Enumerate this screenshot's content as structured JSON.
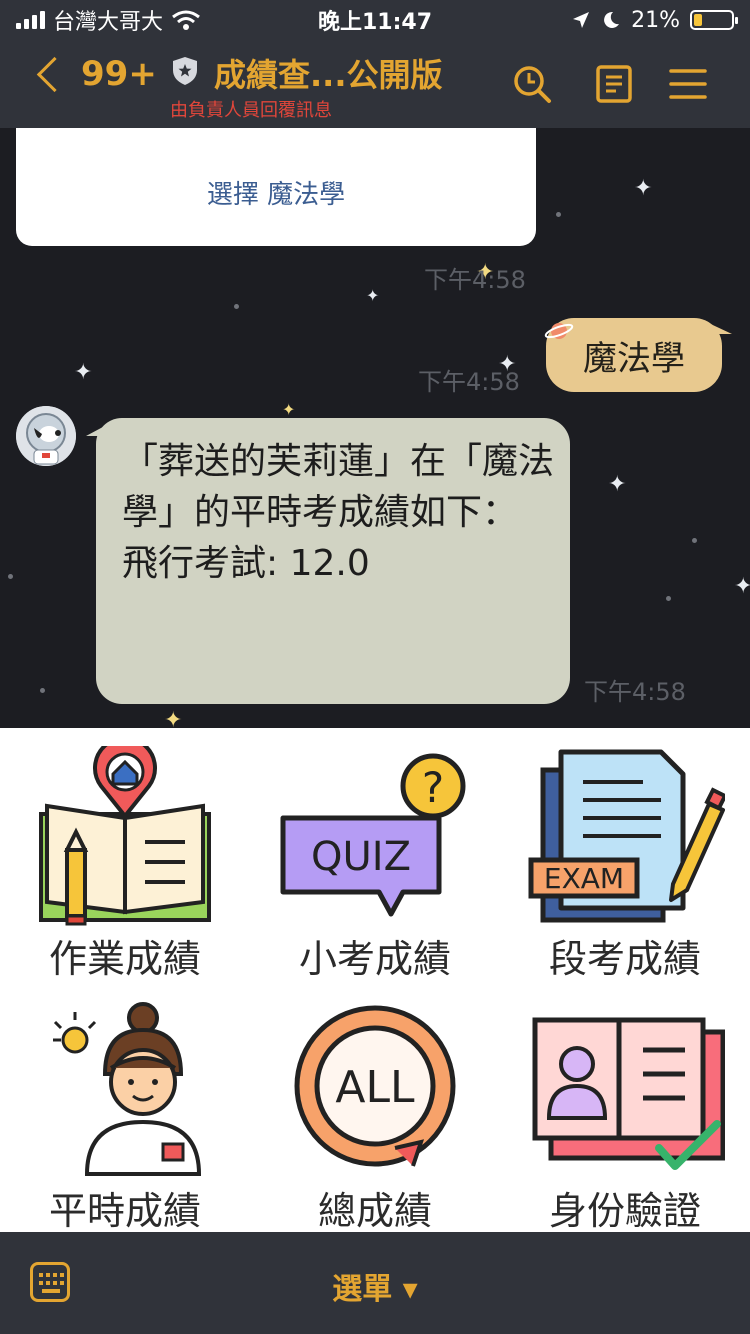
{
  "status_bar": {
    "carrier": "台灣大哥大",
    "time": "晚上11:47",
    "battery": "21%"
  },
  "header": {
    "back_count": "99+",
    "title": "成績查...公開版",
    "subtitle": "由負責人員回覆訊息"
  },
  "chat": {
    "card_button": "選擇 魔法學",
    "messages": [
      {
        "time": "下午4:58"
      },
      {
        "text": "魔法學",
        "time": "下午4:58"
      },
      {
        "text": "「葬送的芙莉蓮」在「魔法學」的平時考成績如下：\n飛行考試: 12.0",
        "time": "下午4:58"
      }
    ]
  },
  "menu": {
    "items": [
      {
        "label": "作業成績",
        "icon": "homework-book-icon"
      },
      {
        "label": "小考成績",
        "icon": "quiz-icon"
      },
      {
        "label": "段考成績",
        "icon": "exam-icon"
      },
      {
        "label": "平時成績",
        "icon": "student-icon"
      },
      {
        "label": "總成績",
        "icon": "all-grades-icon"
      },
      {
        "label": "身份驗證",
        "icon": "id-card-verify-icon"
      }
    ]
  },
  "bottom_bar": {
    "menu_label": "選單 ▾"
  },
  "colors": {
    "accent": "#e3a531",
    "bar": "#30333a",
    "chat_bg": "#1c1d22",
    "my_bubble": "#e8c98f",
    "bot_bubble": "#d1d3c3"
  }
}
